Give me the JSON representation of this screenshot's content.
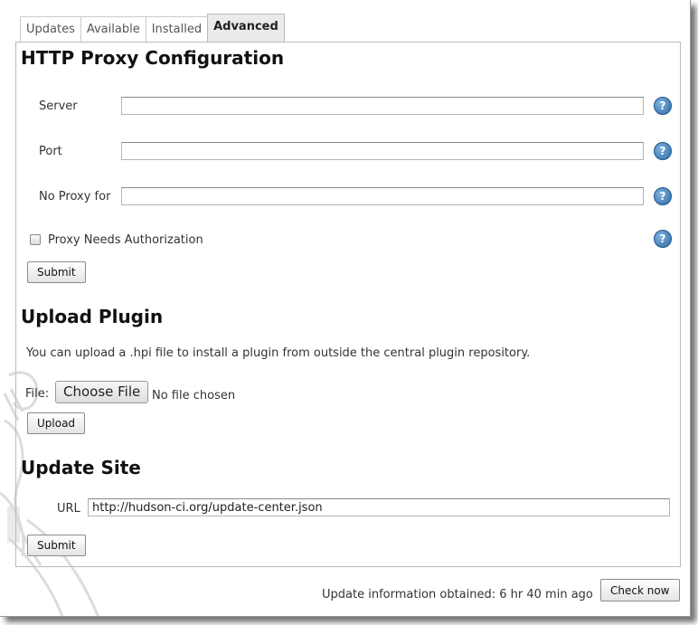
{
  "tabs": [
    "Updates",
    "Available",
    "Installed",
    "Advanced"
  ],
  "active_tab": "Advanced",
  "proxy": {
    "heading": "HTTP Proxy Configuration",
    "server_label": "Server",
    "server_value": "",
    "port_label": "Port",
    "port_value": "",
    "no_proxy_label": "No Proxy for",
    "no_proxy_value": "",
    "auth_label": "Proxy Needs Authorization",
    "auth_checked": false,
    "submit_label": "Submit"
  },
  "upload": {
    "heading": "Upload Plugin",
    "description": "You can upload a .hpi file to install a plugin from outside the central plugin repository.",
    "file_label": "File:",
    "choose_file_label": "Choose File",
    "no_file_text": "No file chosen",
    "upload_label": "Upload"
  },
  "update_site": {
    "heading": "Update Site",
    "url_label": "URL",
    "url_value": "http://hudson-ci.org/update-center.json",
    "submit_label": "Submit"
  },
  "footer": {
    "update_info": "Update information obtained: 6 hr 40 min ago",
    "check_now_label": "Check now"
  },
  "icons": {
    "help": "help-icon"
  },
  "colors": {
    "help_icon": "#2c6aa8",
    "active_tab_bg": "#ebebeb",
    "panel_border": "#bbbbbb"
  }
}
